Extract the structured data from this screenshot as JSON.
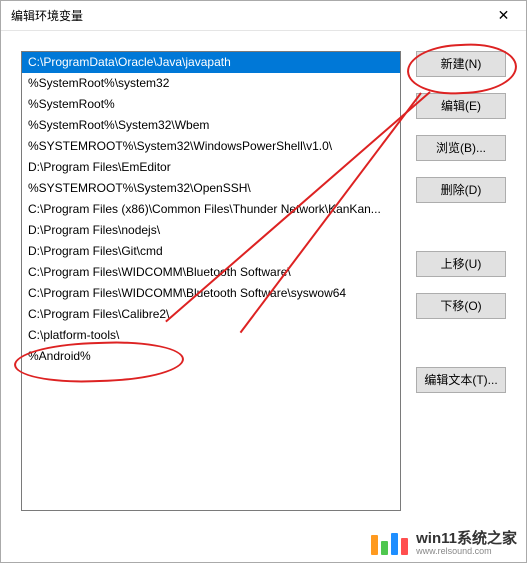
{
  "window": {
    "title": "编辑环境变量"
  },
  "list": {
    "items": [
      "C:\\ProgramData\\Oracle\\Java\\javapath",
      "%SystemRoot%\\system32",
      "%SystemRoot%",
      "%SystemRoot%\\System32\\Wbem",
      "%SYSTEMROOT%\\System32\\WindowsPowerShell\\v1.0\\",
      "D:\\Program Files\\EmEditor",
      "%SYSTEMROOT%\\System32\\OpenSSH\\",
      "C:\\Program Files (x86)\\Common Files\\Thunder Network\\KanKan...",
      "D:\\Program Files\\nodejs\\",
      "D:\\Program Files\\Git\\cmd",
      "C:\\Program Files\\WIDCOMM\\Bluetooth Software\\",
      "C:\\Program Files\\WIDCOMM\\Bluetooth Software\\syswow64",
      "C:\\Program Files\\Calibre2\\",
      "C:\\platform-tools\\",
      "%Android%"
    ],
    "selected_index": 0
  },
  "buttons": {
    "new": "新建(N)",
    "edit": "编辑(E)",
    "browse": "浏览(B)...",
    "delete": "删除(D)",
    "move_up": "上移(U)",
    "move_down": "下移(O)",
    "edit_text": "编辑文本(T)..."
  },
  "watermark": {
    "main": "win11系统之家",
    "sub": "www.relsound.com"
  },
  "icons": {
    "close": "✕"
  }
}
